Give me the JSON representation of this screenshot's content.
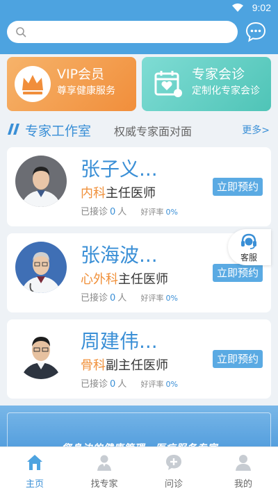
{
  "status_bar": {
    "time": "9:02"
  },
  "search": {
    "value": "",
    "placeholder": ""
  },
  "banners": {
    "vip": {
      "title": "VIP会员",
      "subtitle": "尊享健康服务"
    },
    "consult": {
      "title": "专家会诊",
      "subtitle": "定制化专家会诊"
    }
  },
  "section": {
    "title": "专家工作室",
    "subtitle": "权威专家面对面",
    "more": "更多>"
  },
  "doctors": [
    {
      "name": "张子义...",
      "dept": "内科",
      "rank": "主任医师",
      "visits_label": "已接诊",
      "visits": "0",
      "visits_unit": "人",
      "rating_label": "好评率",
      "rating": "0%",
      "book": "立即预约"
    },
    {
      "name": "张海波...",
      "dept": "心外科",
      "rank": "主任医师",
      "visits_label": "已接诊",
      "visits": "0",
      "visits_unit": "人",
      "rating_label": "好评率",
      "rating": "0%",
      "book": "立即预约"
    },
    {
      "name": "周建伟...",
      "dept": "骨科",
      "rank": "副主任医师",
      "visits_label": "已接诊",
      "visits": "0",
      "visits_unit": "人",
      "rating_label": "好评率",
      "rating": "0%",
      "book": "立即预约"
    }
  ],
  "customer_service": {
    "label": "客服"
  },
  "bottom_banner": {
    "slogan": "您身边的健康管理、医疗服务专家"
  },
  "tabs": [
    {
      "label": "主页",
      "icon": "home-icon",
      "active": true
    },
    {
      "label": "找专家",
      "icon": "doctor-icon",
      "active": false
    },
    {
      "label": "问诊",
      "icon": "chat-add-icon",
      "active": false
    },
    {
      "label": "我的",
      "icon": "user-icon",
      "active": false
    }
  ],
  "colors": {
    "primary": "#4da3e0",
    "accent_blue": "#3a8fd6",
    "vip_orange": "#f18e3b",
    "consult_teal": "#4fc4b7",
    "dept_orange": "#f0903a"
  }
}
